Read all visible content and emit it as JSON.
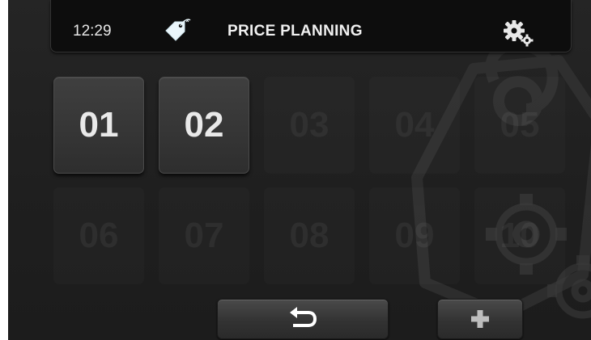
{
  "header": {
    "time": "12:29",
    "title": "PRICE PLANNING",
    "tag_icon": "price-tag-icon",
    "settings_icon": "gears-icon"
  },
  "slots": [
    {
      "label": "01",
      "active": true
    },
    {
      "label": "02",
      "active": true
    },
    {
      "label": "03",
      "active": false
    },
    {
      "label": "04",
      "active": false
    },
    {
      "label": "05",
      "active": false
    },
    {
      "label": "06",
      "active": false
    },
    {
      "label": "07",
      "active": false
    },
    {
      "label": "08",
      "active": false
    },
    {
      "label": "09",
      "active": false
    },
    {
      "label": "10",
      "active": false
    }
  ],
  "footer": {
    "back_icon": "back-arrow-icon",
    "add_icon": "plus-icon"
  },
  "colors": {
    "background": "#222222",
    "header_bar": "#0d0d0d",
    "accent_icon": "#e8f4f8"
  }
}
